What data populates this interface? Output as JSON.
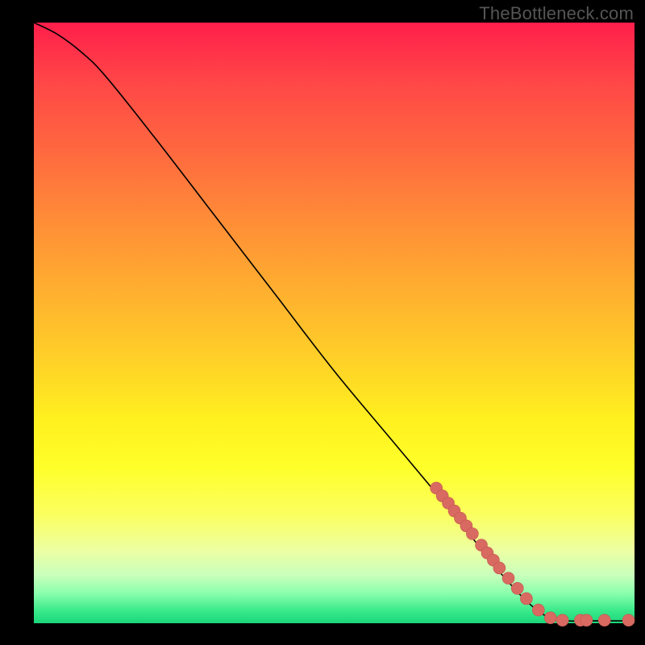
{
  "watermark": "TheBottleneck.com",
  "chart_data": {
    "type": "line",
    "title": "",
    "xlabel": "",
    "ylabel": "",
    "xlim": [
      0,
      100
    ],
    "ylim": [
      0,
      100
    ],
    "grid": false,
    "legend": false,
    "curve": [
      {
        "x": 0,
        "y": 100
      },
      {
        "x": 4,
        "y": 98
      },
      {
        "x": 8,
        "y": 95
      },
      {
        "x": 12,
        "y": 91
      },
      {
        "x": 20,
        "y": 81
      },
      {
        "x": 30,
        "y": 68
      },
      {
        "x": 40,
        "y": 55
      },
      {
        "x": 50,
        "y": 42
      },
      {
        "x": 60,
        "y": 30
      },
      {
        "x": 70,
        "y": 18
      },
      {
        "x": 78,
        "y": 8
      },
      {
        "x": 84,
        "y": 2
      },
      {
        "x": 88,
        "y": 0.5
      },
      {
        "x": 92,
        "y": 0.4
      },
      {
        "x": 96,
        "y": 0.4
      },
      {
        "x": 100,
        "y": 0.4
      }
    ],
    "series": [
      {
        "name": "points",
        "color": "#d86a62",
        "points": [
          {
            "x": 67,
            "y": 22.5
          },
          {
            "x": 68,
            "y": 21.2
          },
          {
            "x": 69,
            "y": 20.0
          },
          {
            "x": 70,
            "y": 18.7
          },
          {
            "x": 71,
            "y": 17.5
          },
          {
            "x": 72,
            "y": 16.2
          },
          {
            "x": 73,
            "y": 14.9
          },
          {
            "x": 74.5,
            "y": 13.0
          },
          {
            "x": 75.5,
            "y": 11.7
          },
          {
            "x": 76.5,
            "y": 10.5
          },
          {
            "x": 77.5,
            "y": 9.2
          },
          {
            "x": 79,
            "y": 7.5
          },
          {
            "x": 80.5,
            "y": 5.8
          },
          {
            "x": 82,
            "y": 4.1
          },
          {
            "x": 84,
            "y": 2.2
          },
          {
            "x": 86,
            "y": 0.9
          },
          {
            "x": 88,
            "y": 0.5
          },
          {
            "x": 91,
            "y": 0.5
          },
          {
            "x": 92,
            "y": 0.5
          },
          {
            "x": 95,
            "y": 0.5
          },
          {
            "x": 99,
            "y": 0.5
          }
        ]
      }
    ]
  }
}
